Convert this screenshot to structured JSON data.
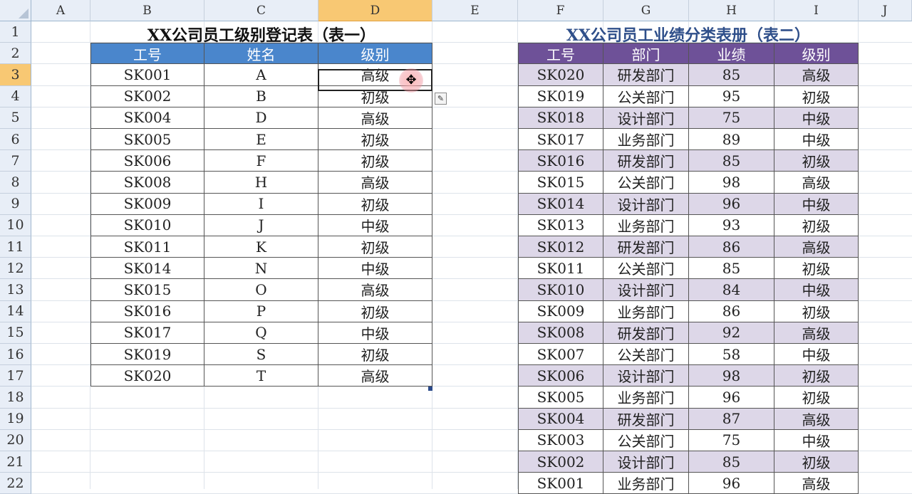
{
  "columns": [
    "A",
    "B",
    "C",
    "D",
    "E",
    "F",
    "G",
    "H",
    "I",
    "J"
  ],
  "rows": [
    "1",
    "2",
    "3",
    "4",
    "5",
    "6",
    "7",
    "8",
    "9",
    "10",
    "11",
    "12",
    "13",
    "14",
    "15",
    "16",
    "17",
    "18",
    "19",
    "20",
    "21",
    "22"
  ],
  "table1": {
    "title": "XX公司员工级别登记表（表一）",
    "headers": [
      "工号",
      "姓名",
      "级别"
    ],
    "rows": [
      [
        "SK001",
        "A",
        "高级"
      ],
      [
        "SK002",
        "B",
        "初级"
      ],
      [
        "SK004",
        "D",
        "高级"
      ],
      [
        "SK005",
        "E",
        "初级"
      ],
      [
        "SK006",
        "F",
        "初级"
      ],
      [
        "SK008",
        "H",
        "高级"
      ],
      [
        "SK009",
        "I",
        "初级"
      ],
      [
        "SK010",
        "J",
        "中级"
      ],
      [
        "SK011",
        "K",
        "初级"
      ],
      [
        "SK014",
        "N",
        "中级"
      ],
      [
        "SK015",
        "O",
        "高级"
      ],
      [
        "SK016",
        "P",
        "初级"
      ],
      [
        "SK017",
        "Q",
        "中级"
      ],
      [
        "SK019",
        "S",
        "初级"
      ],
      [
        "SK020",
        "T",
        "高级"
      ]
    ]
  },
  "table2": {
    "title": "XX公司员工业绩分类表册（表二）",
    "headers": [
      "工号",
      "部门",
      "业绩",
      "级别"
    ],
    "rows": [
      [
        "SK020",
        "研发部门",
        "85",
        "高级"
      ],
      [
        "SK019",
        "公关部门",
        "95",
        "初级"
      ],
      [
        "SK018",
        "设计部门",
        "75",
        "中级"
      ],
      [
        "SK017",
        "业务部门",
        "89",
        "中级"
      ],
      [
        "SK016",
        "研发部门",
        "85",
        "初级"
      ],
      [
        "SK015",
        "公关部门",
        "98",
        "高级"
      ],
      [
        "SK014",
        "设计部门",
        "96",
        "中级"
      ],
      [
        "SK013",
        "业务部门",
        "93",
        "初级"
      ],
      [
        "SK012",
        "研发部门",
        "86",
        "高级"
      ],
      [
        "SK011",
        "公关部门",
        "85",
        "初级"
      ],
      [
        "SK010",
        "设计部门",
        "84",
        "中级"
      ],
      [
        "SK009",
        "业务部门",
        "86",
        "初级"
      ],
      [
        "SK008",
        "研发部门",
        "92",
        "高级"
      ],
      [
        "SK007",
        "公关部门",
        "58",
        "中级"
      ],
      [
        "SK006",
        "设计部门",
        "98",
        "初级"
      ],
      [
        "SK005",
        "业务部门",
        "96",
        "初级"
      ],
      [
        "SK004",
        "研发部门",
        "87",
        "高级"
      ],
      [
        "SK003",
        "公关部门",
        "75",
        "中级"
      ],
      [
        "SK002",
        "设计部门",
        "85",
        "初级"
      ],
      [
        "SK001",
        "业务部门",
        "96",
        "高级"
      ]
    ]
  },
  "selection": {
    "column": "D",
    "row": "3"
  },
  "icons": {
    "cursor": "cross-cursor-icon",
    "paste_options": "paste-options-icon"
  },
  "colors": {
    "table1_header": "#4a86cc",
    "table2_header": "#6e5198",
    "table2_band": "#ddd7e8",
    "table2_title": "#2f4f8a"
  }
}
